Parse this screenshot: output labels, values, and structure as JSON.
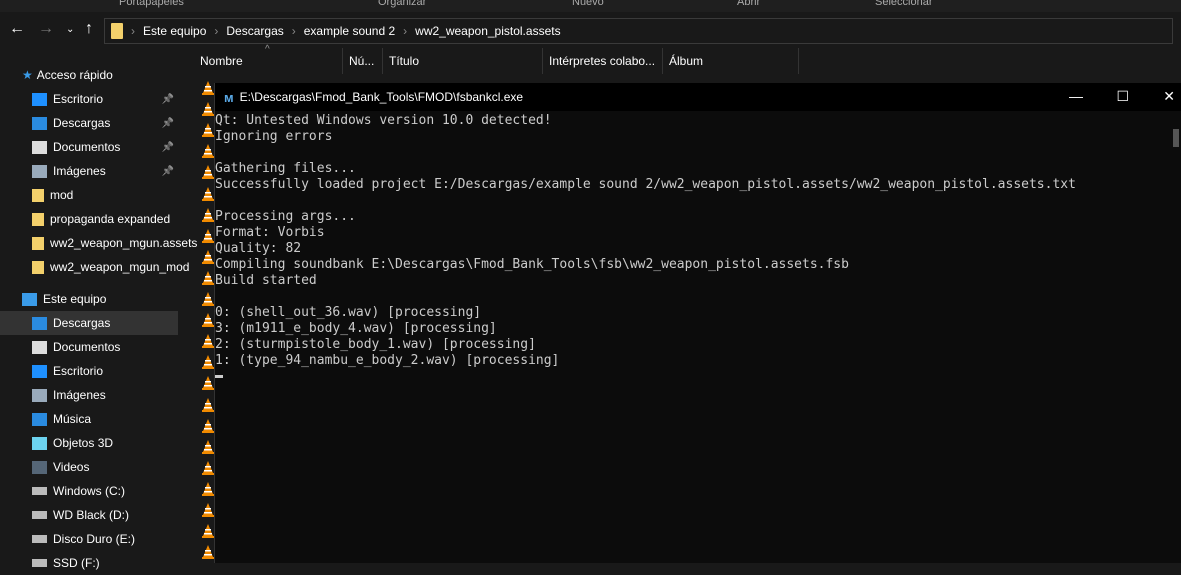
{
  "ribbon": [
    "Portapapeles",
    "Organizar",
    "Nuevo",
    "Abrir",
    "Seleccionar"
  ],
  "breadcrumb": [
    "Este equipo",
    "Descargas",
    "example sound 2",
    "ww2_weapon_pistol.assets"
  ],
  "columns": [
    "Nombre",
    "Nú...",
    "Título",
    "Intérpretes colabo...",
    "Álbum"
  ],
  "sidebar": {
    "quick_access": "Acceso rápido",
    "quick_items": [
      "Escritorio",
      "Descargas",
      "Documentos",
      "Imágenes",
      "mod",
      "propaganda expanded",
      "ww2_weapon_mgun.assets",
      "ww2_weapon_mgun_mod"
    ],
    "this_pc": "Este equipo",
    "pc_items": [
      "Descargas",
      "Documentos",
      "Escritorio",
      "Imágenes",
      "Música",
      "Objetos 3D",
      "Videos",
      "Windows (C:)",
      "WD Black (D:)",
      "Disco Duro (E:)",
      "SSD (F:)"
    ]
  },
  "console": {
    "title": "E:\\Descargas\\Fmod_Bank_Tools\\FMOD\\fsbankcl.exe",
    "lines": [
      "Qt: Untested Windows version 10.0 detected!",
      "Ignoring errors",
      "",
      "Gathering files...",
      "Successfully loaded project E:/Descargas/example sound 2/ww2_weapon_pistol.assets/ww2_weapon_pistol.assets.txt",
      "",
      "Processing args...",
      "Format: Vorbis",
      "Quality: 82",
      "Compiling soundbank E:\\Descargas\\Fmod_Bank_Tools\\fsb\\ww2_weapon_pistol.assets.fsb",
      "Build started",
      "",
      "0: (shell_out_36.wav) [processing]",
      "3: (m1911_e_body_4.wav) [processing]",
      "2: (sturmpistole_body_1.wav) [processing]",
      "1: (type_94_nambu_e_body_2.wav) [processing]"
    ]
  },
  "colors": {
    "vlc": "#f08a00",
    "folder": "#f3d06b",
    "accent": "#1e90ff"
  }
}
